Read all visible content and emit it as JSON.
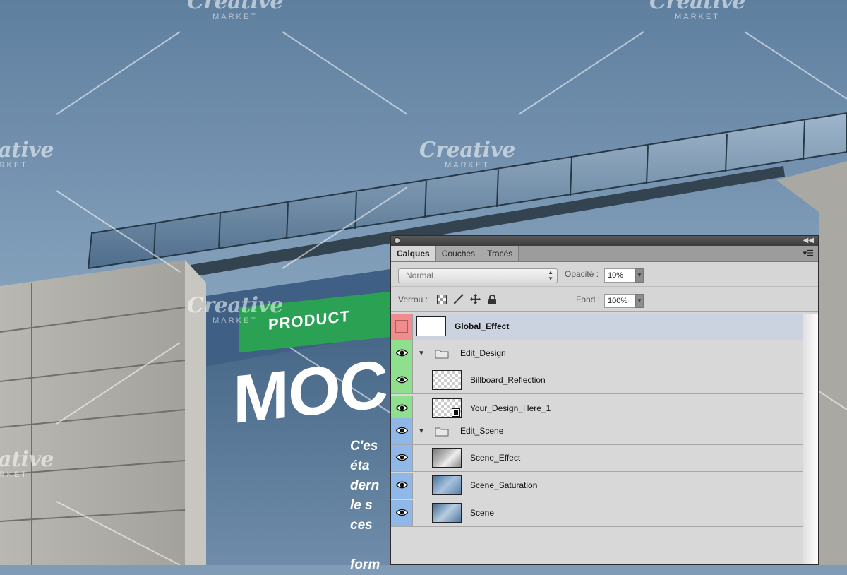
{
  "watermark": {
    "brand": "Creative",
    "sub": "MARKET"
  },
  "background_banner": {
    "product_text": "PRODUCT",
    "title_text": "MOC",
    "body_lines": [
      "C'es",
      "éta",
      "dern",
      "le s",
      "ces",
      "",
      "form"
    ]
  },
  "panel": {
    "tabs": [
      {
        "label": "Calques",
        "active": true
      },
      {
        "label": "Couches",
        "active": false
      },
      {
        "label": "Tracés",
        "active": false
      }
    ],
    "blend_mode": "Normal",
    "opacity_label": "Opacité :",
    "opacity_value": "10%",
    "lock_label": "Verrou :",
    "fill_label": "Fond :",
    "fill_value": "100%",
    "layers": [
      {
        "name": "Global_Effect",
        "kind": "layer",
        "eye_color": "#f08c8c",
        "visible": false,
        "selected": true,
        "indent": 0,
        "bold": true
      },
      {
        "name": "Edit_Design",
        "kind": "group",
        "eye_color": "#8ee08e",
        "visible": true,
        "selected": false,
        "indent": 0,
        "bold": false
      },
      {
        "name": "Billboard_Reflection",
        "kind": "layer",
        "eye_color": "#8ee08e",
        "visible": true,
        "selected": false,
        "indent": 1,
        "bold": false
      },
      {
        "name": "Your_Design_Here_1",
        "kind": "smart",
        "eye_color": "#8ee08e",
        "visible": true,
        "selected": false,
        "indent": 1,
        "bold": false
      },
      {
        "name": "Edit_Scene",
        "kind": "group",
        "eye_color": "#8fb8e8",
        "visible": true,
        "selected": false,
        "indent": 0,
        "bold": false
      },
      {
        "name": "Scene_Effect",
        "kind": "layer",
        "eye_color": "#8fb8e8",
        "visible": true,
        "selected": false,
        "indent": 1,
        "bold": false
      },
      {
        "name": "Scene_Saturation",
        "kind": "layer",
        "eye_color": "#8fb8e8",
        "visible": true,
        "selected": false,
        "indent": 1,
        "bold": false
      },
      {
        "name": "Scene",
        "kind": "layer",
        "eye_color": "#8fb8e8",
        "visible": true,
        "selected": false,
        "indent": 1,
        "bold": false
      }
    ]
  }
}
